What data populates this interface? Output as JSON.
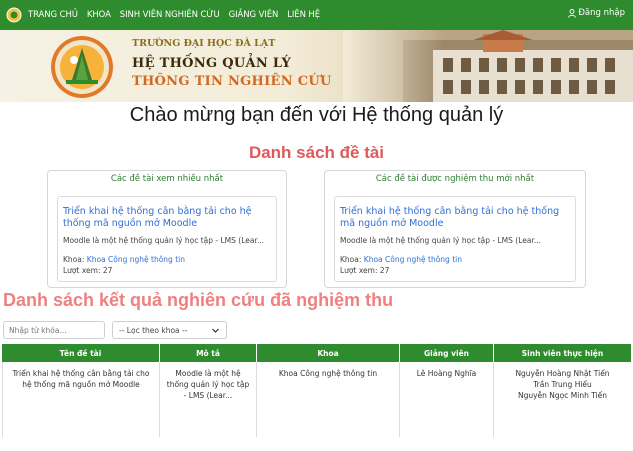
{
  "nav": {
    "items": [
      "TRANG CHỦ",
      "KHOA",
      "SINH VIÊN NGHIÊN CỨU",
      "GIẢNG VIÊN",
      "LIÊN HỆ"
    ],
    "login_label": "Đăng nhập"
  },
  "banner": {
    "university": "TRƯỜNG ĐẠI HỌC ĐÀ LẠT",
    "title_line1": "HỆ THỐNG QUẢN LÝ",
    "title_line2": "THÔNG TIN NGHIÊN CỨU",
    "logo_text": "ĐẠI HỌC ĐÀ LẠT"
  },
  "welcome": "Chào mừng bạn đến với Hệ thống quản lý",
  "topics_title": "Danh sách đề tài",
  "most_viewed": {
    "heading": "Các đề tài xem nhiều nhất",
    "title": "Triển khai hệ thống cân bằng tải cho hệ thống mã nguồn mở Moodle",
    "description": "Moodle là một hệ thống quản lý học tập - LMS (Lear...",
    "dept_label": "Khoa:",
    "dept_value": "Khoa Công nghệ thông tin",
    "views": "Lượt xem: 27"
  },
  "latest_accepted": {
    "heading": "Các đề tài được nghiệm thu mới nhất",
    "title": "Triển khai hệ thống cân bằng tải cho hệ thống mã nguồn mở Moodle",
    "description": "Moodle là một hệ thống quản lý học tập - LMS (Lear...",
    "dept_label": "Khoa:",
    "dept_value": "Khoa Công nghệ thông tin",
    "views": "Lượt xem: 27"
  },
  "results_title": "Danh sách kết quả nghiên cứu đã nghiệm thu",
  "filters": {
    "search_placeholder": "Nhập từ khóa...",
    "dept_select": "-- Lọc theo khoa --"
  },
  "table": {
    "headers": [
      "Tên đề tài",
      "Mô tả",
      "Khoa",
      "Giảng viên",
      "Sinh viên thực hiện"
    ],
    "rows": [
      {
        "title": "Triển khai hệ thống cân bằng tải cho hệ thống mã nguồn mở Moodle",
        "description": "Moodle là một hệ thống quản lý học tập - LMS (Lear...",
        "department": "Khoa Công nghệ thông tin",
        "lecturer": "Lê Hoàng Nghĩa",
        "students": [
          "Nguyễn Hoàng Nhật Tiến",
          "Trần Trung Hiếu",
          "Nguyễn Ngọc Minh Tiến"
        ]
      }
    ]
  },
  "colors": {
    "navbar": "#2e8b2e",
    "section_title": "#e05a5a",
    "results_title": "#f08080",
    "link": "#2f6fd6"
  }
}
